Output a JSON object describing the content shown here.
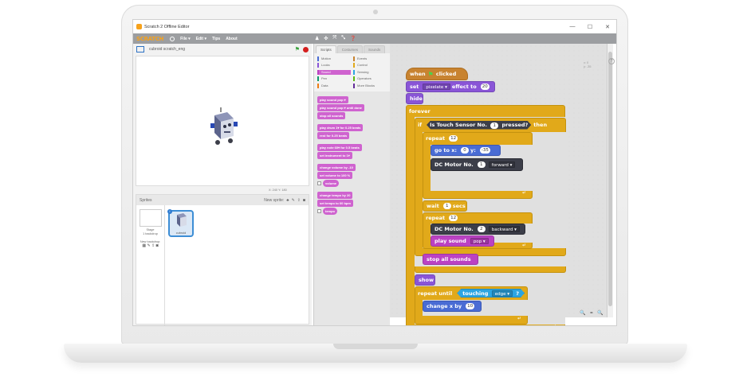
{
  "window": {
    "title": "Scratch 2 Offline Editor",
    "controls": [
      "—",
      "☐",
      "✕"
    ]
  },
  "menubar": {
    "logo": "SCRATCH",
    "items": [
      "File ▾",
      "Edit ▾",
      "Tips",
      "About"
    ]
  },
  "stage": {
    "project_name": "cubroid scratch_eng",
    "coords": "X: 240  Y: 180"
  },
  "sprites": {
    "header": "Sprites",
    "new_sprite": "New sprite:",
    "stage_label": "Stage",
    "stage_sub": "1 backdrop",
    "new_backdrop": "New backdrop:",
    "sprite_name": "cubroid",
    "sprite_info": "i"
  },
  "palette": {
    "tabs": [
      "Scripts",
      "Costumes",
      "Sounds"
    ],
    "categories": [
      {
        "label": "Motion",
        "color": "#4a6cd4"
      },
      {
        "label": "Events",
        "color": "#c88330"
      },
      {
        "label": "Looks",
        "color": "#8a55d7"
      },
      {
        "label": "Control",
        "color": "#e1a91a"
      },
      {
        "label": "Sound",
        "color": "#bb42c3"
      },
      {
        "label": "Sensing",
        "color": "#2ca5e2"
      },
      {
        "label": "Pen",
        "color": "#0e9a6c"
      },
      {
        "label": "Operators",
        "color": "#5cb712"
      },
      {
        "label": "Data",
        "color": "#ee7d16"
      },
      {
        "label": "More Blocks",
        "color": "#632d99"
      }
    ],
    "blocks": [
      "play sound pop ▾",
      "play sound pop ▾ until done",
      "stop all sounds",
      "play drum 1▾ for 0.25 beats",
      "rest for 0.25 beats",
      "play note 60▾ for 0.5 beats",
      "set instrument to 1▾",
      "change volume by -10",
      "set volume to 100 %",
      "volume",
      "change tempo by 20",
      "set tempo to 60 bpm",
      "tempo"
    ]
  },
  "script": {
    "hat": {
      "when": "when",
      "clicked": "clicked"
    },
    "set_effect": {
      "set": "set",
      "effect": "pixelate ▾",
      "to": "effect to",
      "value": "20"
    },
    "hide": "hide",
    "forever": "forever",
    "if": {
      "label": "if",
      "sensor": "Is Touch Sensor No.",
      "num": "1",
      "pressed": "pressed?",
      "then": "then"
    },
    "repeat1": {
      "label": "repeat",
      "value": "12"
    },
    "goto": {
      "label": "go to x:",
      "x": "0",
      "ylabel": "y:",
      "y": "-35"
    },
    "motor1": {
      "label": "DC Motor No.",
      "num": "1",
      "dir": "forward ▾"
    },
    "wait": {
      "label": "wait",
      "value": "1",
      "unit": "secs"
    },
    "repeat2": {
      "label": "repeat",
      "value": "12"
    },
    "motor2": {
      "label": "DC Motor No.",
      "num": "2",
      "dir": "backward ▾"
    },
    "play_sound": {
      "label": "play sound",
      "sound": "pop ▾"
    },
    "stop_sounds": "stop all sounds",
    "show": "show",
    "repeat_until": {
      "label": "repeat until",
      "touching": "touching",
      "target": "edge ▾",
      "q": "?"
    },
    "change_x": {
      "label": "change x by",
      "value": "10"
    }
  },
  "scripts_area": {
    "sprite_coords": "x: 0\ny: -35",
    "zoom": "🔍 = 🔍",
    "help": "?"
  }
}
